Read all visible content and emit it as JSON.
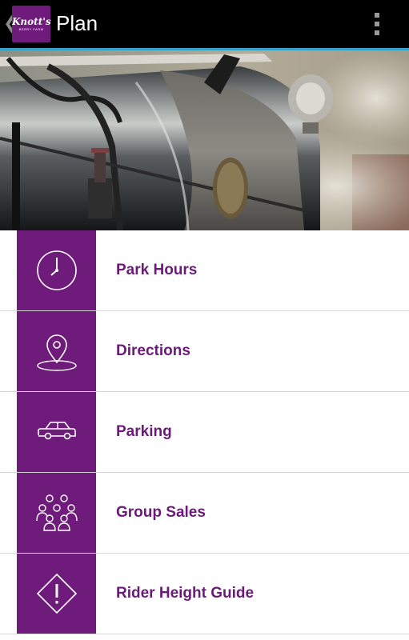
{
  "action_bar": {
    "back_icon": "chevron-left-icon",
    "logo_text": "Knott's",
    "logo_subtext": "BERRY FARM",
    "title": "Plan",
    "overflow_icon": "overflow-menu-icon"
  },
  "hero": {
    "description_icon": "steam-locomotive-photo"
  },
  "menu": {
    "items": [
      {
        "label": "Park Hours",
        "icon": "clock-icon"
      },
      {
        "label": "Directions",
        "icon": "map-pin-icon"
      },
      {
        "label": "Parking",
        "icon": "car-icon"
      },
      {
        "label": "Group Sales",
        "icon": "group-icon"
      },
      {
        "label": "Rider Height Guide",
        "icon": "warning-diamond-icon"
      }
    ]
  },
  "colors": {
    "brand_purple": "#6f1b7b",
    "label_purple": "#6a1b77",
    "action_bar": "#000000",
    "accent_line": "#33a3c9"
  }
}
